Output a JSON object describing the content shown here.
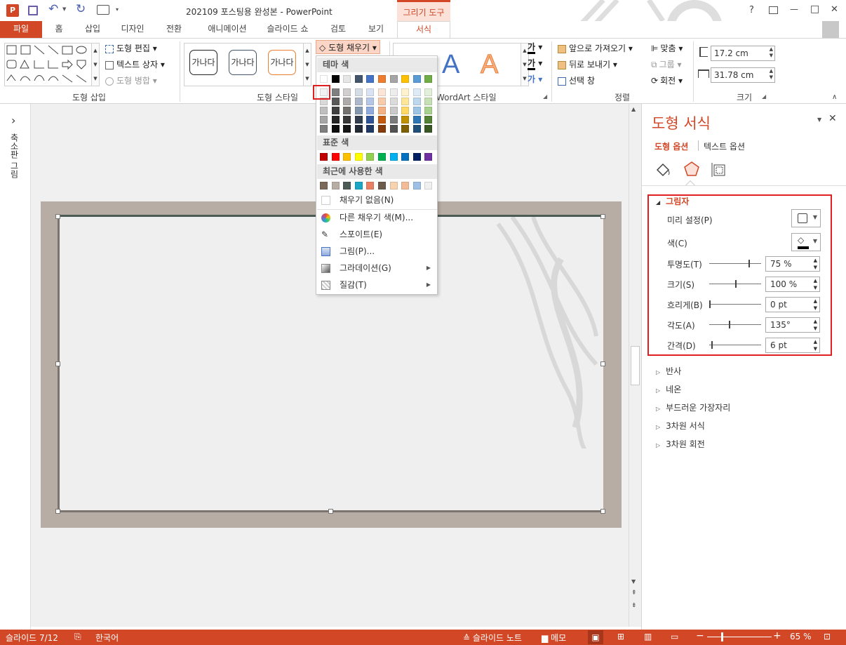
{
  "window": {
    "title": "202109 포스팅용 완성본 - PowerPoint",
    "context_tab": "그리기 도구",
    "help": "?",
    "minimize": "—",
    "maximize": "□",
    "close": "✕"
  },
  "tabs": {
    "file": "파일",
    "home": "홈",
    "insert": "삽입",
    "design": "디자인",
    "transitions": "전환",
    "animations": "애니메이션",
    "slideshow": "슬라이드 쇼",
    "review": "검토",
    "view": "보기",
    "format": "서식"
  },
  "ribbon": {
    "insert_shapes": {
      "label": "도형 삽입",
      "edit_shape": "도형 편집",
      "text_box": "텍스트 상자",
      "merge_shapes": "도형 병합"
    },
    "shape_styles": {
      "label": "도형 스타일",
      "preset_text": "가나다",
      "fill": "도형 채우기"
    },
    "wordart": {
      "label": "WordArt 스타일",
      "letter": "A",
      "text_fill": "가",
      "text_outline": "가",
      "effects": "가"
    },
    "arrange": {
      "label": "정렬",
      "bring_forward": "앞으로 가져오기",
      "send_backward": "뒤로 보내기",
      "selection_pane": "선택 창",
      "align": "맞춤",
      "group": "그룹",
      "rotate": "회전"
    },
    "size": {
      "label": "크기",
      "height": "17.2 cm",
      "width": "31.78 cm"
    }
  },
  "dropdown": {
    "theme_colors_header": "테마 색",
    "standard_colors_header": "표준 색",
    "recent_colors_header": "최근에 사용한 색",
    "no_fill": "채우기 없음(N)",
    "more_colors": "다른 채우기 색(M)...",
    "eyedropper": "스포이트(E)",
    "picture": "그림(P)...",
    "gradient": "그라데이션(G)",
    "texture": "질감(T)",
    "theme_top": [
      "#ffffff",
      "#000000",
      "#e7e6e6",
      "#44546a",
      "#4472c4",
      "#ed7d31",
      "#a5a5a5",
      "#ffc000",
      "#5b9bd5",
      "#70ad47"
    ],
    "theme_shades": [
      [
        "#f2f2f2",
        "#d9d9d9",
        "#bfbfbf",
        "#a6a6a6",
        "#7f7f7f"
      ],
      [
        "#7f7f7f",
        "#595959",
        "#404040",
        "#262626",
        "#0d0d0d"
      ],
      [
        "#d0cece",
        "#aeaaaa",
        "#757171",
        "#3a3838",
        "#171616"
      ],
      [
        "#d6dce4",
        "#adb9ca",
        "#8497b0",
        "#333f4f",
        "#222a35"
      ],
      [
        "#dae3f3",
        "#b4c7e7",
        "#8faadc",
        "#2f5597",
        "#1f3864"
      ],
      [
        "#fbe5d6",
        "#f8cbad",
        "#f4b183",
        "#c55a11",
        "#843c0c"
      ],
      [
        "#ededed",
        "#dbdbdb",
        "#c9c9c9",
        "#7b7b7b",
        "#525252"
      ],
      [
        "#fff2cc",
        "#ffe699",
        "#ffd966",
        "#bf9000",
        "#7f6000"
      ],
      [
        "#deebf7",
        "#bdd7ee",
        "#9dc3e6",
        "#2e75b6",
        "#1f4e79"
      ],
      [
        "#e2f0d9",
        "#c5e0b4",
        "#a9d18e",
        "#538135",
        "#385723"
      ]
    ],
    "standard": [
      "#c00000",
      "#ff0000",
      "#ffc000",
      "#ffff00",
      "#92d050",
      "#00b050",
      "#00b0f0",
      "#0070c0",
      "#002060",
      "#7030a0"
    ],
    "recent": [
      "#7b6a5a",
      "#b8ada4",
      "#4c5b56",
      "#1aa6c4",
      "#e98063",
      "#6c5c4c",
      "#f8d3b0",
      "#f3bc98",
      "#9fc0e6",
      "#f0f0f0"
    ]
  },
  "leftpane": {
    "expand": "›",
    "label": "축소판 그림"
  },
  "format_pane": {
    "title": "도형 서식",
    "tab_shape_options": "도형 옵션",
    "tab_text_options": "텍스트 옵션",
    "shadow": {
      "header": "그림자",
      "preset": "미리 설정(P)",
      "color": "색(C)",
      "rows": [
        {
          "label": "투명도(T)",
          "value": "75 %",
          "level": 0.75
        },
        {
          "label": "크기(S)",
          "value": "100 %",
          "level": 0.5
        },
        {
          "label": "흐리게(B)",
          "value": "0 pt",
          "level": 0.0
        },
        {
          "label": "각도(A)",
          "value": "135°",
          "level": 0.375
        },
        {
          "label": "간격(D)",
          "value": "6 pt",
          "level": 0.04
        }
      ]
    },
    "sections": [
      "반사",
      "네온",
      "부드러운 가장자리",
      "3차원 서식",
      "3차원 회전"
    ]
  },
  "statusbar": {
    "slide": "슬라이드 7/12",
    "language": "한국어",
    "notes": "슬라이드 노트",
    "comments": "메모",
    "zoom": "65 %"
  },
  "colors": {
    "accent": "#d24726",
    "highlight_red": "#e02020",
    "slide_frame": "#b8ada4"
  }
}
